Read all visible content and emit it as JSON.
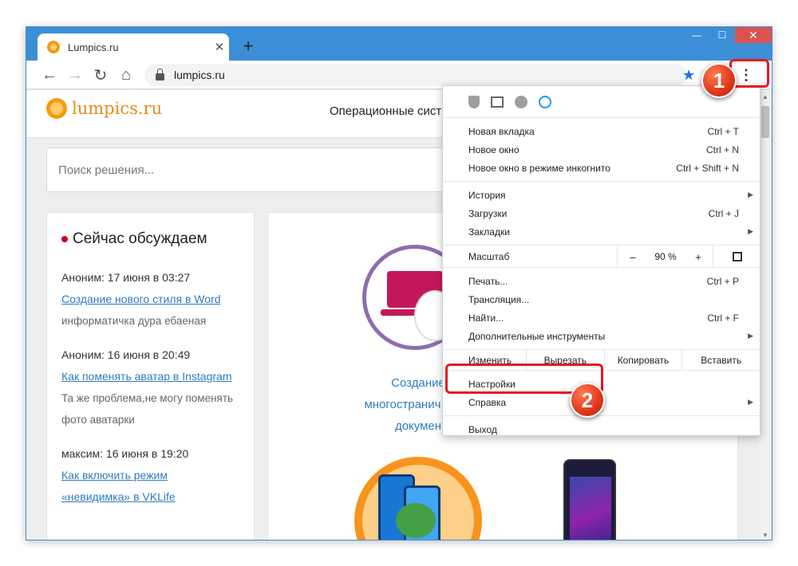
{
  "browser": {
    "tab_title": "Lumpics.ru",
    "tab_close": "✕",
    "new_tab": "+",
    "url": "lumpics.ru",
    "window_controls": {
      "minimize": "—",
      "maximize": "☐",
      "close": "✕"
    }
  },
  "site": {
    "logo_text": "lumpics.ru",
    "nav_text": "Операционные сист",
    "search_placeholder": "Поиск решения...",
    "sidebar_title": "Сейчас обсуждаем",
    "comments": [
      {
        "meta": "Аноним: 17 июня в 03:27",
        "link": "Создание нового стиля в Word",
        "body": "информатичка дура ебаеная"
      },
      {
        "meta": "Аноним: 16 июня в 20:49",
        "link": "Как поменять аватар в Instagram",
        "body": "Та же проблема,не могу поменять фото аватарки"
      },
      {
        "meta": "максим: 16 июня в 19:20",
        "link": "Как включить режим «невидимка» в VKLife",
        "body": ""
      }
    ],
    "card_title": "Создание многостранич PDF-докумен"
  },
  "menu": {
    "group1": [
      {
        "label": "Новая вкладка",
        "shortcut": "Ctrl + T"
      },
      {
        "label": "Новое окно",
        "shortcut": "Ctrl + N"
      },
      {
        "label": "Новое окно в режиме инкогнито",
        "shortcut": "Ctrl + Shift + N"
      }
    ],
    "group2": [
      {
        "label": "История",
        "shortcut": ""
      },
      {
        "label": "Загрузки",
        "shortcut": "Ctrl + J"
      },
      {
        "label": "Закладки",
        "shortcut": ""
      }
    ],
    "zoom_label": "Масштаб",
    "zoom_minus": "–",
    "zoom_value": "90 %",
    "zoom_plus": "+",
    "group3": [
      {
        "label": "Печать...",
        "shortcut": "Ctrl + P"
      },
      {
        "label": "Трансляция...",
        "shortcut": ""
      },
      {
        "label": "Найти...",
        "shortcut": "Ctrl + F"
      },
      {
        "label": "Дополнительные инструменты",
        "shortcut": ""
      }
    ],
    "edit_label": "Изменить",
    "edit_cut": "Вырезать",
    "edit_copy": "Копировать",
    "edit_paste": "Вставить",
    "settings": "Настройки",
    "help": "Справка",
    "exit": "Выход"
  },
  "annotations": {
    "step1": "1",
    "step2": "2",
    "accent": "#e5181f"
  }
}
